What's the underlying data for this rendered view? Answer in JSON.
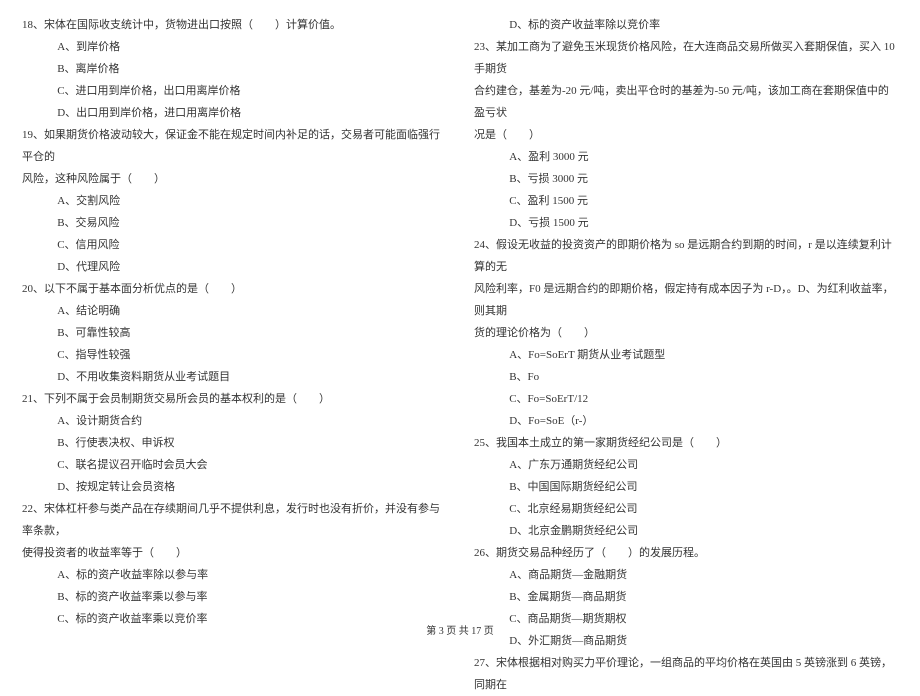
{
  "left": {
    "q18": {
      "stem": "18、宋体在国际收支统计中，货物进出口按照（　　）计算价值。",
      "a": "A、到岸价格",
      "b": "B、离岸价格",
      "c": "C、进口用到岸价格，出口用离岸价格",
      "d": "D、出口用到岸价格，进口用离岸价格"
    },
    "q19": {
      "stem": "19、如果期货价格波动较大，保证金不能在规定时间内补足的话，交易者可能面临强行平仓的",
      "stem2": "风险，这种风险属于（　　）",
      "a": "A、交割风险",
      "b": "B、交易风险",
      "c": "C、信用风险",
      "d": "D、代理风险"
    },
    "q20": {
      "stem": "20、以下不属于基本面分析优点的是（　　）",
      "a": "A、结论明确",
      "b": "B、可靠性较高",
      "c": "C、指导性较强",
      "d": "D、不用收集资料期货从业考试题目"
    },
    "q21": {
      "stem": "21、下列不属于会员制期货交易所会员的基本权利的是（　　）",
      "a": "A、设计期货合约",
      "b": "B、行使表决权、申诉权",
      "c": "C、联名提议召开临时会员大会",
      "d": "D、按规定转让会员资格"
    },
    "q22": {
      "stem": "22、宋体杠杆参与类产品在存续期间几乎不提供利息，发行时也没有折价，并没有参与率条款，",
      "stem2": "使得投资者的收益率等于（　　）",
      "a": "A、标的资产收益率除以参与率",
      "b": "B、标的资产收益率乘以参与率",
      "c": "C、标的资产收益率乘以竞价率"
    }
  },
  "right": {
    "q22d": "D、标的资产收益率除以竞价率",
    "q23": {
      "stem": "23、某加工商为了避免玉米现货价格风险，在大连商品交易所做买入套期保值，买入 10 手期货",
      "stem2": "合约建仓，基差为-20 元/吨，卖出平仓时的基差为-50 元/吨，该加工商在套期保值中的盈亏状",
      "stem3": "况是（　　）",
      "a": "A、盈利 3000 元",
      "b": "B、亏损 3000 元",
      "c": "C、盈利 1500 元",
      "d": "D、亏损 1500 元"
    },
    "q24": {
      "stem": "24、假设无收益的投资资产的即期价格为 so 是远期合约到期的时间，r 是以连续复利计算的无",
      "stem2": "风险利率，F0 是远期合约的即期价格，假定持有成本因子为 r-D，。D、为红利收益率，则其期",
      "stem3": "货的理论价格为（　　）",
      "a": "A、Fo=SoErT 期货从业考试题型",
      "b": "B、Fo",
      "c": "C、Fo=SoErT/12",
      "d": "D、Fo=SoE（r-）"
    },
    "q25": {
      "stem": "25、我国本土成立的第一家期货经纪公司是（　　）",
      "a": "A、广东万通期货经纪公司",
      "b": "B、中国国际期货经纪公司",
      "c": "C、北京经易期货经纪公司",
      "d": "D、北京金鹏期货经纪公司"
    },
    "q26": {
      "stem": "26、期货交易品种经历了（　　）的发展历程。",
      "a": "A、商品期货—金融期货",
      "b": "B、金属期货—商品期货",
      "c": "C、商品期货—期货期权",
      "d": "D、外汇期货—商品期货"
    },
    "q27": {
      "stem": "27、宋体根据相对购买力平价理论，一组商品的平均价格在英国由 5 英镑涨到 6 英镑，同期在"
    }
  },
  "footer": "第 3 页 共 17 页"
}
